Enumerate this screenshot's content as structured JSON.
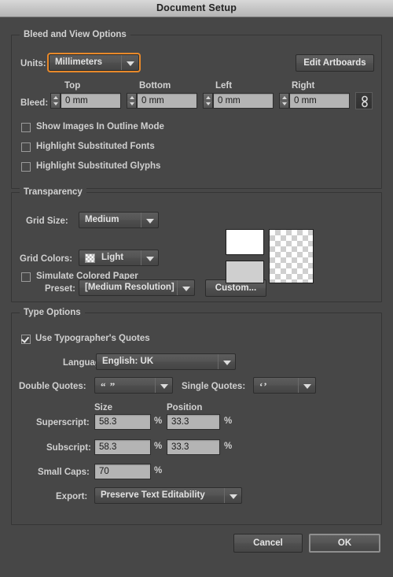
{
  "window": {
    "title": "Document Setup"
  },
  "colors": {
    "dialog_bg": "#474747",
    "titlebar_top": "#d8d8d8",
    "field_bg": "#b4b4b4",
    "focus_accent": "#e8892a",
    "text": "#d0d0d0"
  },
  "bleed_and_view": {
    "group_label": "Bleed and View Options",
    "units_label": "Units:",
    "units_value": "Millimeters",
    "edit_artboards_label": "Edit Artboards",
    "bleed_label": "Bleed:",
    "bleed_columns": [
      "Top",
      "Bottom",
      "Left",
      "Right"
    ],
    "bleed_values": [
      "0 mm",
      "0 mm",
      "0 mm",
      "0 mm"
    ],
    "link_icon": "chain-link-icon",
    "checkboxes": [
      {
        "label": "Show Images In Outline Mode",
        "checked": false
      },
      {
        "label": "Highlight Substituted Fonts",
        "checked": false
      },
      {
        "label": "Highlight Substituted Glyphs",
        "checked": false
      }
    ]
  },
  "transparency": {
    "group_label": "Transparency",
    "grid_size_label": "Grid Size:",
    "grid_size_value": "Medium",
    "grid_colors_label": "Grid Colors:",
    "grid_colors_value": "Light",
    "grid_colors_swatch_icon": "checkerboard-swatch-icon",
    "simulate_paper_label": "Simulate Colored Paper",
    "simulate_paper_checked": false,
    "preset_label": "Preset:",
    "preset_value": "[Medium Resolution]",
    "custom_label": "Custom...",
    "swatch_1_color": "#ffffff",
    "swatch_2_color": "#cfcfcf",
    "preview_icon": "transparency-grid-preview"
  },
  "type_options": {
    "group_label": "Type Options",
    "typographers_quotes_label": "Use Typographer's Quotes",
    "typographers_quotes_checked": true,
    "language_label": "Language:",
    "language_value": "English: UK",
    "double_quotes_label": "Double Quotes:",
    "double_quotes_value": "“ ”",
    "single_quotes_label": "Single Quotes:",
    "single_quotes_value": "‘’",
    "col_size": "Size",
    "col_position": "Position",
    "superscript_label": "Superscript:",
    "superscript_size": "58.3",
    "superscript_position": "33.3",
    "subscript_label": "Subscript:",
    "subscript_size": "58.3",
    "subscript_position": "33.3",
    "small_caps_label": "Small Caps:",
    "small_caps_value": "70",
    "percent": "%",
    "export_label": "Export:",
    "export_value": "Preserve Text Editability"
  },
  "footer": {
    "cancel_label": "Cancel",
    "ok_label": "OK"
  }
}
